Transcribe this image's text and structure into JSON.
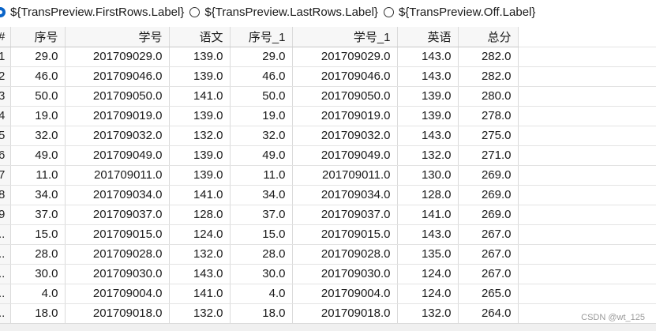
{
  "preview_options": [
    {
      "label": "${TransPreview.FirstRows.Label}",
      "checked": true
    },
    {
      "label": "${TransPreview.LastRows.Label}",
      "checked": false
    },
    {
      "label": "${TransPreview.Off.Label}",
      "checked": false
    }
  ],
  "table": {
    "rownum_header": "#",
    "columns": [
      "序号",
      "学号",
      "语文",
      "序号_1",
      "学号_1",
      "英语",
      "总分"
    ],
    "rows": [
      {
        "rn": "1",
        "cells": [
          "29.0",
          "201709029.0",
          "139.0",
          "29.0",
          "201709029.0",
          "143.0",
          "282.0"
        ]
      },
      {
        "rn": "2",
        "cells": [
          "46.0",
          "201709046.0",
          "139.0",
          "46.0",
          "201709046.0",
          "143.0",
          "282.0"
        ]
      },
      {
        "rn": "3",
        "cells": [
          "50.0",
          "201709050.0",
          "141.0",
          "50.0",
          "201709050.0",
          "139.0",
          "280.0"
        ]
      },
      {
        "rn": "4",
        "cells": [
          "19.0",
          "201709019.0",
          "139.0",
          "19.0",
          "201709019.0",
          "139.0",
          "278.0"
        ]
      },
      {
        "rn": "5",
        "cells": [
          "32.0",
          "201709032.0",
          "132.0",
          "32.0",
          "201709032.0",
          "143.0",
          "275.0"
        ]
      },
      {
        "rn": "6",
        "cells": [
          "49.0",
          "201709049.0",
          "139.0",
          "49.0",
          "201709049.0",
          "132.0",
          "271.0"
        ]
      },
      {
        "rn": "7",
        "cells": [
          "11.0",
          "201709011.0",
          "139.0",
          "11.0",
          "201709011.0",
          "130.0",
          "269.0"
        ]
      },
      {
        "rn": "8",
        "cells": [
          "34.0",
          "201709034.0",
          "141.0",
          "34.0",
          "201709034.0",
          "128.0",
          "269.0"
        ]
      },
      {
        "rn": "9",
        "cells": [
          "37.0",
          "201709037.0",
          "128.0",
          "37.0",
          "201709037.0",
          "141.0",
          "269.0"
        ]
      },
      {
        "rn": "..",
        "cells": [
          "15.0",
          "201709015.0",
          "124.0",
          "15.0",
          "201709015.0",
          "143.0",
          "267.0"
        ]
      },
      {
        "rn": "..",
        "cells": [
          "28.0",
          "201709028.0",
          "132.0",
          "28.0",
          "201709028.0",
          "135.0",
          "267.0"
        ]
      },
      {
        "rn": "..",
        "cells": [
          "30.0",
          "201709030.0",
          "143.0",
          "30.0",
          "201709030.0",
          "124.0",
          "267.0"
        ]
      },
      {
        "rn": "..",
        "cells": [
          "4.0",
          "201709004.0",
          "141.0",
          "4.0",
          "201709004.0",
          "124.0",
          "265.0"
        ]
      },
      {
        "rn": "..",
        "cells": [
          "18.0",
          "201709018.0",
          "132.0",
          "18.0",
          "201709018.0",
          "132.0",
          "264.0"
        ]
      }
    ]
  },
  "watermark": "CSDN @wt_125"
}
